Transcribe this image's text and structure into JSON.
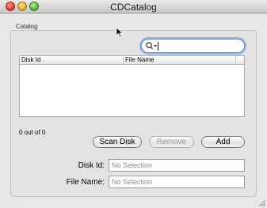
{
  "window": {
    "title": "CDCatalog"
  },
  "catalog": {
    "group_label": "Catalog",
    "search": {
      "value": "",
      "placeholder": ""
    },
    "table": {
      "columns": [
        "Disk Id",
        "File Name"
      ],
      "rows": []
    },
    "count_text": "0 out of 0"
  },
  "buttons": {
    "scan_disk": "Scan Disk",
    "remove": "Remove",
    "add": "Add"
  },
  "detail": {
    "disk_id_label": "Disk Id:",
    "disk_id_value": "No Selection",
    "file_name_label": "File Name:",
    "file_name_value": "No Selection"
  },
  "icons": {
    "close": "close-icon",
    "minimize": "minimize-icon",
    "zoom": "zoom-icon",
    "search": "search-icon",
    "cursor": "mouse-cursor-icon",
    "resize": "resize-grip-icon"
  }
}
